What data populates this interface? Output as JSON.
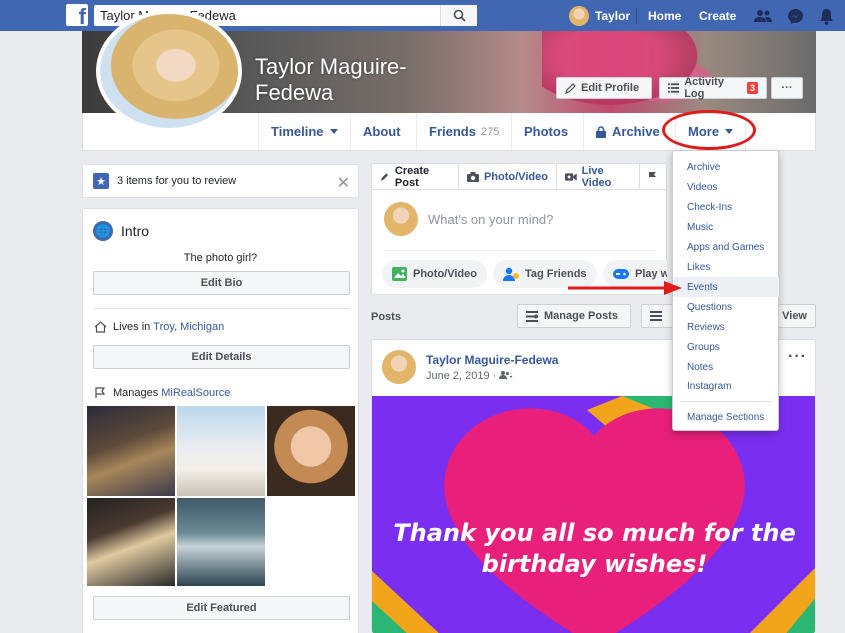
{
  "topbar": {
    "search_value": "Taylor Maguire-Fedewa",
    "user_name": "Taylor",
    "home_label": "Home",
    "create_label": "Create",
    "colors": {
      "bar": "#4267b2"
    }
  },
  "profile": {
    "name": "Taylor Maguire-Fedewa",
    "edit_profile_label": "Edit Profile",
    "activity_log_label": "Activity Log",
    "activity_log_badge": "3",
    "more_dots": "···"
  },
  "tabs": {
    "timeline": "Timeline",
    "about": "About",
    "friends": "Friends",
    "friends_count": "275",
    "photos": "Photos",
    "archive": "Archive",
    "more": "More"
  },
  "review": {
    "text": "3 items for you to review"
  },
  "intro": {
    "title": "Intro",
    "bio": "The photo girl?",
    "edit_bio_label": "Edit Bio",
    "lives_in_prefix": "Lives in",
    "lives_in_place": "Troy, Michigan",
    "edit_details_label": "Edit Details",
    "manages_prefix": "Manages",
    "manages_page": "MiRealSource",
    "edit_featured_label": "Edit Featured"
  },
  "composer": {
    "create_post": "Create Post",
    "photo_video": "Photo/Video",
    "live_video": "Live Video",
    "placeholder": "What's on your mind?",
    "pill_photo_video": "Photo/Video",
    "pill_tag_friends": "Tag Friends",
    "pill_play_with": "Play wit"
  },
  "posts": {
    "label": "Posts",
    "manage_posts": "Manage Posts",
    "view_label": "View"
  },
  "post": {
    "author": "Taylor Maguire-Fedewa",
    "date": "June 2, 2019 · ",
    "image_text": "Thank you all so much for the birthday wishes!",
    "menu": "···"
  },
  "menu": {
    "items": [
      "Archive",
      "Videos",
      "Check-Ins",
      "Music",
      "Apps and Games",
      "Likes",
      "Events",
      "Questions",
      "Reviews",
      "Groups",
      "Notes",
      "Instagram"
    ],
    "manage_sections": "Manage Sections",
    "highlighted": "Events"
  }
}
